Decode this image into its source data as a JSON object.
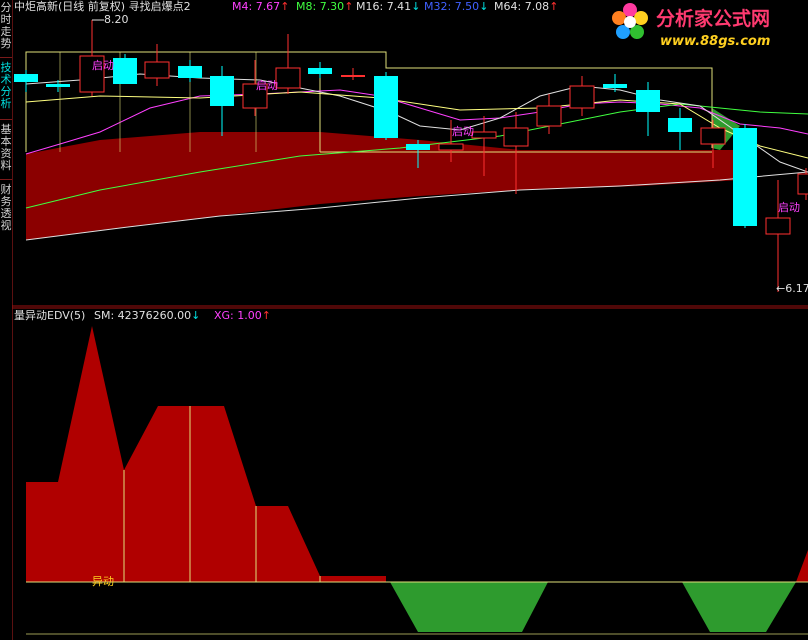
{
  "sidebar": {
    "tabs": [
      {
        "label": "分时走势",
        "active": false
      },
      {
        "label": "技术分析",
        "active": true
      },
      {
        "label": "基本资料",
        "active": false
      },
      {
        "label": "财务透视",
        "active": false
      }
    ]
  },
  "main_header": {
    "title": "中炬高新(日线 前复权) 寻找启爆点2",
    "ma": [
      {
        "label": "M4: 7.67",
        "arrow": "↑",
        "color": "#ff40ff",
        "arrow_color": "#ff3030"
      },
      {
        "label": "M8: 7.30",
        "arrow": "↑",
        "color": "#40ff40",
        "arrow_color": "#ff3030"
      },
      {
        "label": "M16: 7.41",
        "arrow": "↓",
        "color": "#e0e0e0",
        "arrow_color": "#00e0e0"
      },
      {
        "label": "M32: 7.50",
        "arrow": "↓",
        "color": "#4060ff",
        "arrow_color": "#00e0e0"
      },
      {
        "label": "M64: 7.08",
        "arrow": "↑",
        "color": "#e0e0e0",
        "arrow_color": "#ff3030"
      }
    ],
    "high_marker": "8.20",
    "low_marker": "←6.17",
    "signal_label": "启动"
  },
  "sub_header": {
    "title": "量异动EDV(5)",
    "sm_label": "SM: 42376260.00",
    "sm_arrow": "↓",
    "xg_label": "XG: 1.00",
    "xg_arrow": "↑",
    "yd_label": "异动"
  },
  "watermark": {
    "brand": "分析家公式网",
    "url": "www.88gs.com"
  },
  "colors": {
    "up": "#ff3030",
    "down": "#00ffff",
    "area": "#8b0000",
    "green_area": "#2e9b2e",
    "box": "#e0e07a",
    "ma4": "#ff40ff",
    "ma8": "#40ff40",
    "ma16": "#e0e0e0",
    "ma32": "#4060ff",
    "ma64": "#e0e0e0"
  }
}
